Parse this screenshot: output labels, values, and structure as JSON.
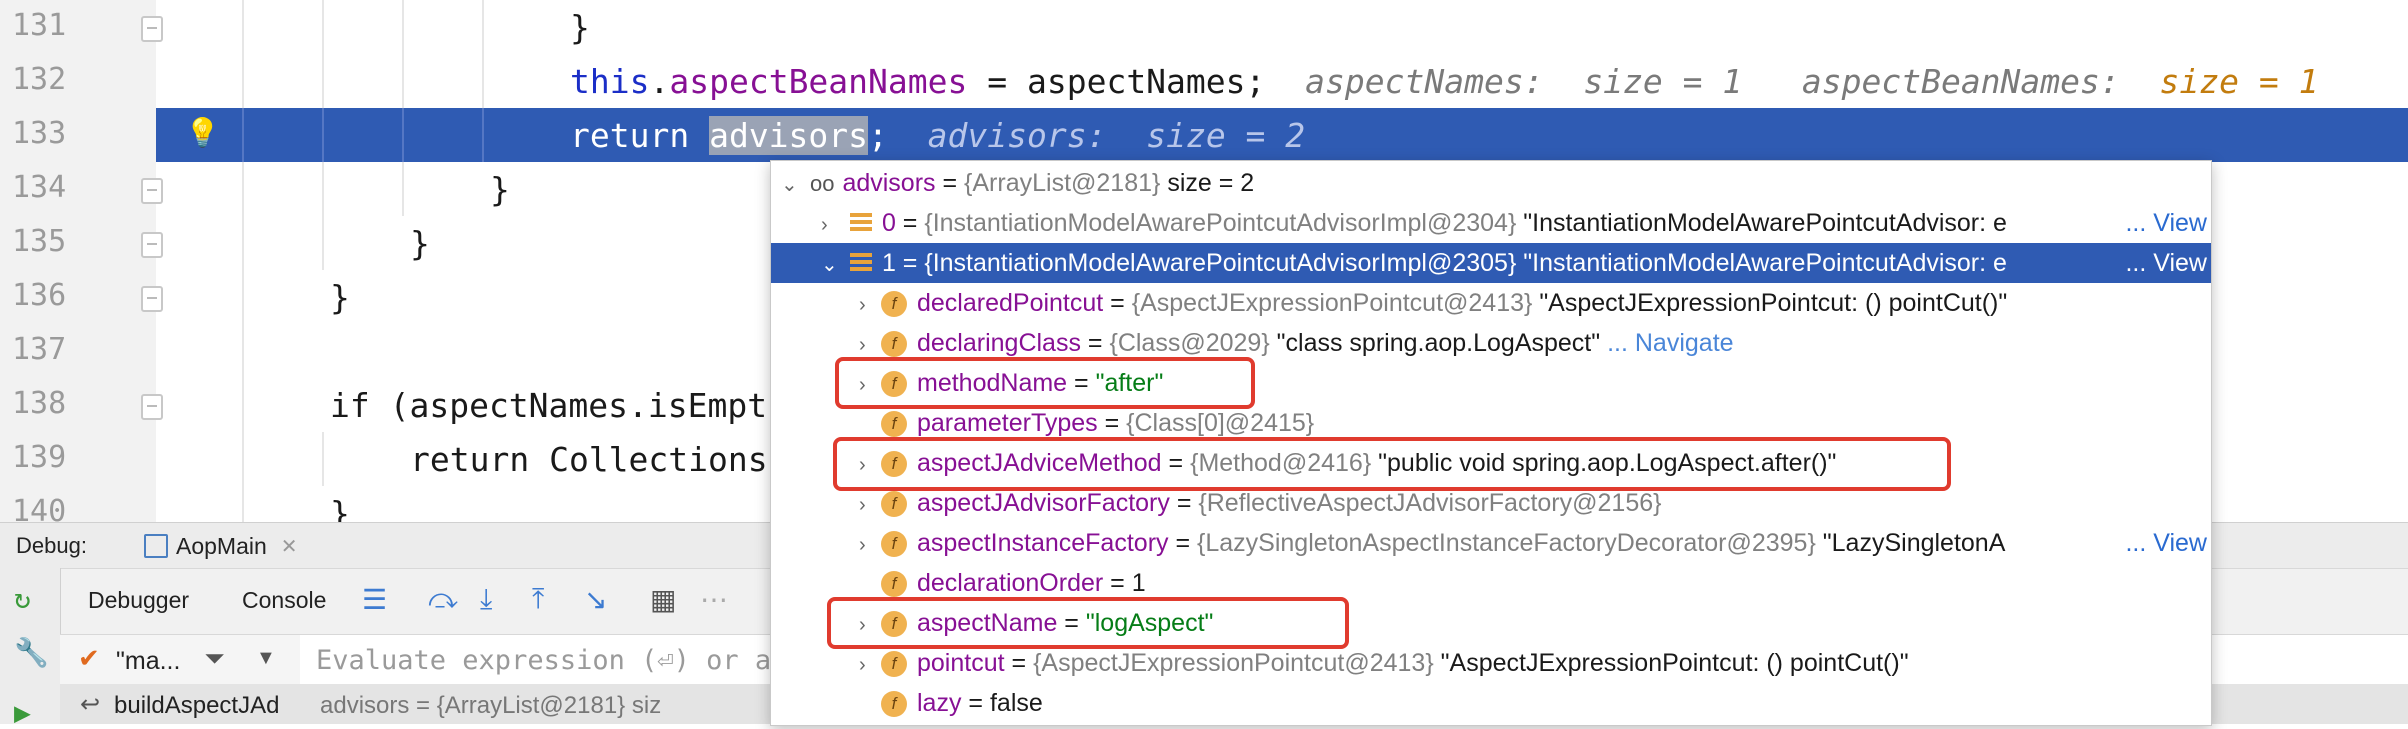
{
  "editor": {
    "lines": [
      {
        "num": "131",
        "text": "}"
      },
      {
        "num": "132",
        "kw": "this",
        "field": "aspectBeanNames",
        "rest": " = aspectNames;",
        "hint1_name": "aspectNames:",
        "hint1_val": "size = 1",
        "hint2_name": "aspectBeanNames:",
        "hint2_val": "size = 1"
      },
      {
        "num": "133",
        "kw": "return ",
        "sel": "advisors",
        "rest": ";",
        "hint_name": "advisors:",
        "hint_val": "size = 2"
      },
      {
        "num": "134",
        "text": "}"
      },
      {
        "num": "135",
        "text": "}"
      },
      {
        "num": "136",
        "text": "}"
      },
      {
        "num": "137",
        "text": ""
      },
      {
        "num": "138",
        "text": "if (aspectNames.isEmpt"
      },
      {
        "num": "139",
        "text": "return Collections"
      },
      {
        "num": "140",
        "text": "}"
      }
    ]
  },
  "debug": {
    "label": "Debug:",
    "config_tab": "AopMain",
    "tabs": [
      "Debugger",
      "Console"
    ],
    "thread_filter": "\"ma...",
    "eval_placeholder": "Evaluate expression (⏎) or ad",
    "frame": "buildAspectJAd",
    "frame_var": "advisors = {ArrayList@2181} siz"
  },
  "popup": {
    "root": {
      "name": "advisors",
      "type": "{ArrayList@2181}",
      "text": "size = 2"
    },
    "items": [
      {
        "name": "0",
        "type": "{InstantiationModelAwarePointcutAdvisorImpl@2304}",
        "text": "\"InstantiationModelAwarePointcutAdvisor: e",
        "view": "... View"
      },
      {
        "name": "1",
        "type": "{InstantiationModelAwarePointcutAdvisorImpl@2305}",
        "text": "\"InstantiationModelAwarePointcutAdvisor: e",
        "view": "... View"
      }
    ],
    "fields": [
      {
        "name": "declaredPointcut",
        "type": "{AspectJExpressionPointcut@2413}",
        "text": "\"AspectJExpressionPointcut: () pointCut()\"",
        "expand": true
      },
      {
        "name": "declaringClass",
        "type": "{Class@2029}",
        "text": "\"class spring.aop.LogAspect\"",
        "nav": "... Navigate",
        "expand": true
      },
      {
        "name": "methodName",
        "str": "\"after\"",
        "expand": true
      },
      {
        "name": "parameterTypes",
        "type": "{Class[0]@2415}",
        "expand": false
      },
      {
        "name": "aspectJAdviceMethod",
        "type": "{Method@2416}",
        "text": "\"public void spring.aop.LogAspect.after()\"",
        "expand": true
      },
      {
        "name": "aspectJAdvisorFactory",
        "type": "{ReflectiveAspectJAdvisorFactory@2156}",
        "expand": true
      },
      {
        "name": "aspectInstanceFactory",
        "type": "{LazySingletonAspectInstanceFactoryDecorator@2395}",
        "text": "\"LazySingletonA",
        "view": "... View",
        "expand": true
      },
      {
        "name": "declarationOrder",
        "text": "1",
        "expand": false
      },
      {
        "name": "aspectName",
        "str": "\"logAspect\"",
        "expand": true
      },
      {
        "name": "pointcut",
        "type": "{AspectJExpressionPointcut@2413}",
        "text": "\"AspectJExpressionPointcut: () pointCut()\"",
        "expand": true
      },
      {
        "name": "lazy",
        "text": "false",
        "expand": false
      }
    ],
    "eq": " = "
  },
  "colors": {
    "highlight": "#2f5bb3",
    "annotation": "#e03b2e"
  }
}
